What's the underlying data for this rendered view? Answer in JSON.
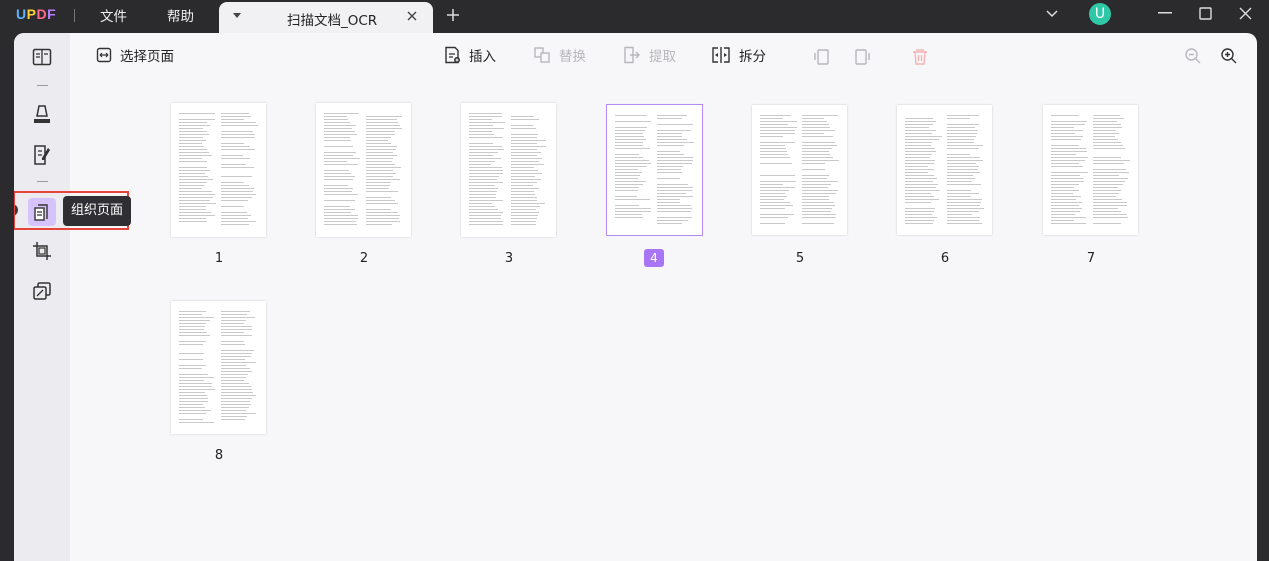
{
  "app": {
    "logo": "UPDF",
    "menus": [
      "文件",
      "帮助"
    ],
    "avatar_letter": "U"
  },
  "tab": {
    "title": "扫描文档_OCR"
  },
  "toolbar": {
    "select_pages": "选择页面",
    "insert": "插入",
    "replace": "替换",
    "extract": "提取",
    "split": "拆分"
  },
  "sidebar": {
    "tooltip": "组织页面",
    "active": "organize-pages"
  },
  "pages": [
    {
      "label": "1"
    },
    {
      "label": "2"
    },
    {
      "label": "3"
    },
    {
      "label": "4",
      "selected": true
    },
    {
      "label": "5"
    },
    {
      "label": "6"
    },
    {
      "label": "7"
    },
    {
      "label": "8"
    }
  ],
  "colors": {
    "accent": "#a875f5",
    "highlight": "#e5453a",
    "avatar": "#2fc8a6"
  }
}
